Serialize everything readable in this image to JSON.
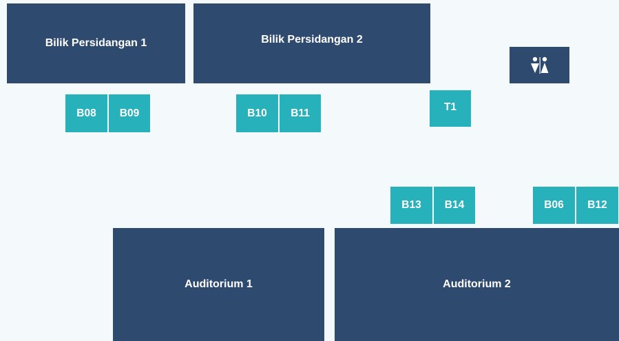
{
  "colors": {
    "background": "#f4f9fc",
    "room": "#2f4a6f",
    "booth": "#27b1bb",
    "text": "#ffffff"
  },
  "rooms": {
    "bilik_1": "Bilik Persidangan 1",
    "bilik_2": "Bilik Persidangan 2",
    "auditorium_1": "Auditorium 1",
    "auditorium_2": "Auditorium 2"
  },
  "booths": {
    "b08": "B08",
    "b09": "B09",
    "b10": "B10",
    "b11": "B11",
    "t1": "T1",
    "b13": "B13",
    "b14": "B14",
    "b06": "B06",
    "b12": "B12"
  },
  "icons": {
    "restroom": "restroom-icon"
  }
}
